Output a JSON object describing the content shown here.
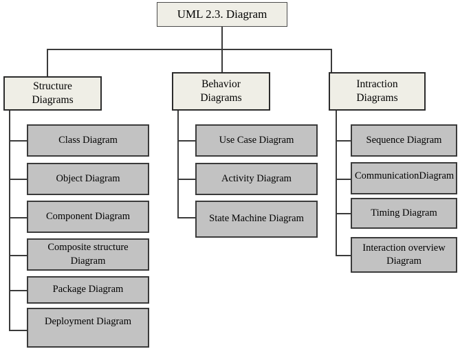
{
  "diagram": {
    "title": "UML 2.3. Diagram",
    "root": {
      "label": "UML 2.3. Diagram"
    },
    "categories": [
      {
        "label": "Structure\nDiagrams",
        "line1": "Structure",
        "line2": "Diagrams",
        "children": [
          {
            "label": "Class Diagram"
          },
          {
            "label": "Object Diagram"
          },
          {
            "label": "Component Diagram"
          },
          {
            "label": "Composite structure Diagram"
          },
          {
            "label": "Package Diagram"
          },
          {
            "label": "Deployment Diagram"
          }
        ]
      },
      {
        "label": "Behavior\nDiagrams",
        "line1": "Behavior",
        "line2": "Diagrams",
        "children": [
          {
            "label": "Use Case Diagram"
          },
          {
            "label": "Activity Diagram"
          },
          {
            "label": "State Machine Diagram"
          }
        ]
      },
      {
        "label": "Intraction\nDiagrams",
        "line1": "Intraction",
        "line2": "Diagrams",
        "children": [
          {
            "label": "Sequence Diagram"
          },
          {
            "label": "CommunicationDiagram"
          },
          {
            "label": "Timing Diagram"
          },
          {
            "label": "Interaction overview Diagram"
          }
        ]
      }
    ]
  },
  "colors": {
    "root_fill": "#efeee6",
    "category_fill": "#efeee6",
    "leaf_fill": "#c2c2c2",
    "border": "#3a3a3a",
    "line": "#3a3a3a",
    "background": "#ffffff",
    "text": "#000000"
  }
}
